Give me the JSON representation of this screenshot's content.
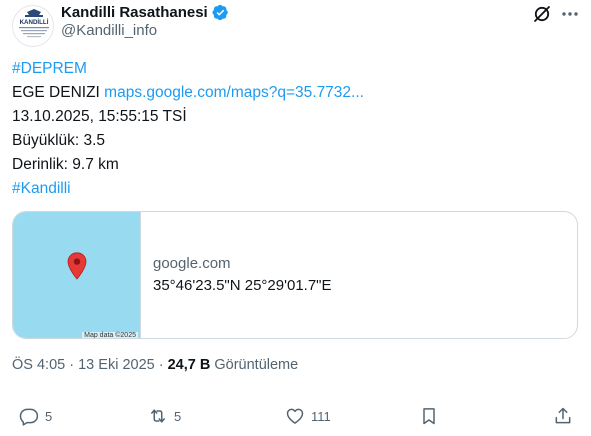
{
  "author": {
    "display_name": "Kandilli Rasathanesi",
    "handle": "@Kandilli_info",
    "avatar_text": "KANDİLLİ"
  },
  "tweet": {
    "hashtag_top": "#DEPREM",
    "location": "EGE DENIZI",
    "link_text": "maps.google.com/maps?q=35.7732...",
    "datetime": "13.10.2025, 15:55:15 TSİ",
    "magnitude": "Büyüklük: 3.5",
    "depth": "Derinlik: 9.7 km",
    "hashtag_bottom": "#Kandilli"
  },
  "card": {
    "domain": "google.com",
    "title": "35°46'23.5\"N 25°29'01.7\"E",
    "map_attribution": "Map data ©2025"
  },
  "meta": {
    "time": "ÖS 4:05",
    "separator": "·",
    "date": "13 Eki 2025",
    "views_count": "24,7 B",
    "views_label": "Görüntüleme"
  },
  "actions": {
    "replies": "5",
    "reposts": "5",
    "likes": "111"
  },
  "colors": {
    "link": "#1d9bf0",
    "verified": "#1d9bf0",
    "secondary_text": "#536471",
    "map_water": "#98dbf0",
    "pin": "#e53935"
  },
  "icons": [
    "verified-badge-icon",
    "grok-icon",
    "more-icon",
    "map-pin-icon",
    "reply-icon",
    "repost-icon",
    "like-icon",
    "bookmark-icon",
    "share-icon"
  ]
}
